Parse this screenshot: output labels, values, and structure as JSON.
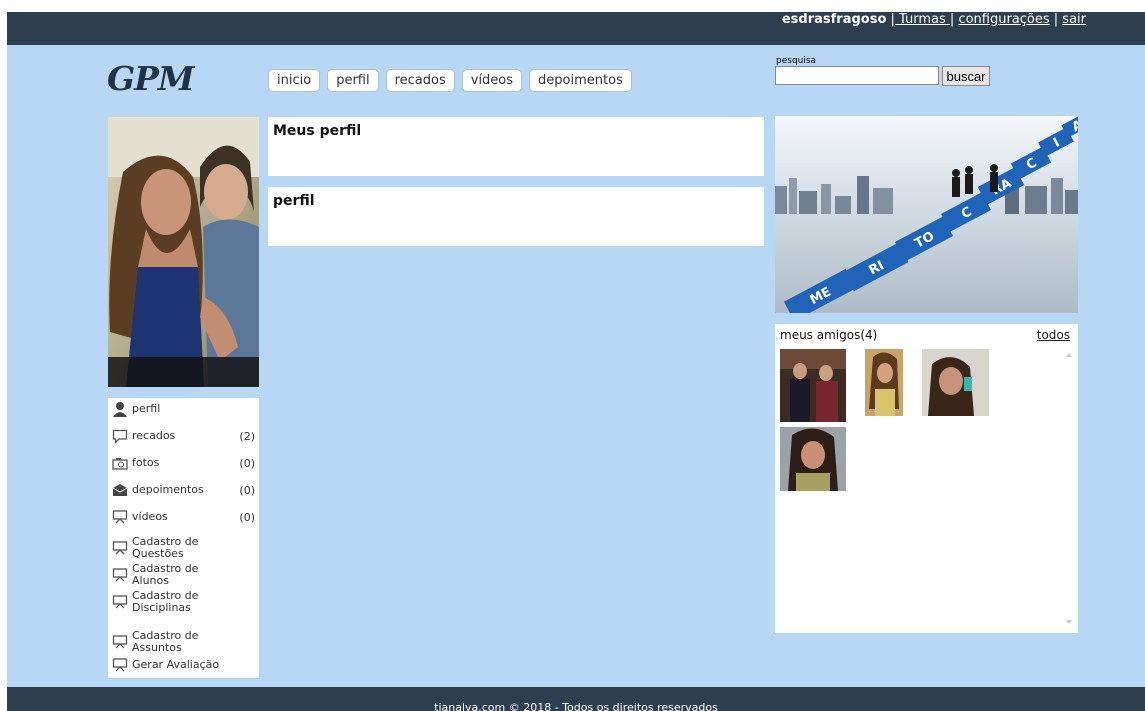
{
  "header": {
    "username": "esdrasfragoso",
    "links": [
      " Turmas ",
      "configurações",
      "sair"
    ]
  },
  "logo": "GPM",
  "tabs": [
    "inicio",
    "perfil",
    "recados",
    "vídeos",
    "depoimentos"
  ],
  "search": {
    "label": "pesquisa",
    "value": "",
    "button": "buscar"
  },
  "sidebar": {
    "items": [
      {
        "label": "perfil",
        "count": "",
        "icon": "user-icon"
      },
      {
        "label": "recados",
        "count": "(2)",
        "icon": "speech-bubble-icon"
      },
      {
        "label": "fotos",
        "count": "(0)",
        "icon": "camera-icon"
      },
      {
        "label": "depoimentos",
        "count": "(0)",
        "icon": "envelope-icon"
      },
      {
        "label": "vídeos",
        "count": "(0)",
        "icon": "presentation-icon"
      },
      {
        "label": "Cadastro de Questões",
        "count": "",
        "icon": "presentation-icon"
      },
      {
        "label": "Cadastro de Alunos",
        "count": "",
        "icon": "presentation-icon"
      },
      {
        "label": "Cadastro de Disciplinas",
        "count": "",
        "icon": "presentation-icon"
      },
      {
        "label": "Cadastro de Assuntos",
        "count": "",
        "icon": "presentation-icon"
      },
      {
        "label": "Gerar Avaliação",
        "count": "",
        "icon": "presentation-icon"
      }
    ]
  },
  "main": {
    "panels": [
      {
        "title": "Meus perfil"
      },
      {
        "title": "perfil"
      }
    ]
  },
  "banner": {
    "letters": [
      "ME",
      "RI",
      "TO",
      "C",
      "RA",
      "C",
      "I",
      "A"
    ]
  },
  "friends": {
    "title": "meus amigos(4)",
    "all_link": "todos"
  },
  "footer": "tianalva.com © 2018 - Todos os direitos reservados"
}
